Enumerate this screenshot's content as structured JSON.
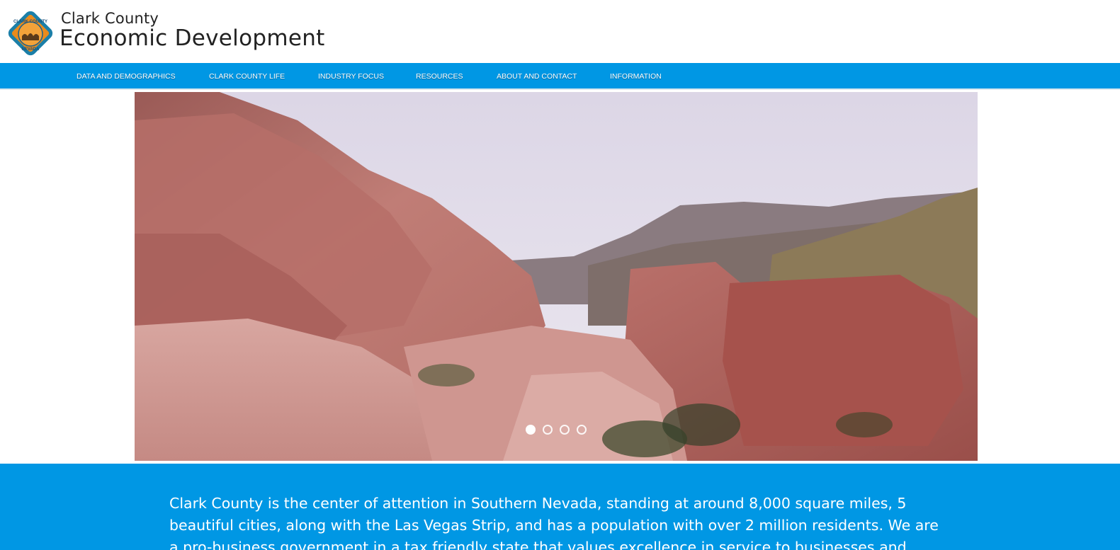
{
  "header": {
    "title_small": "Clark County",
    "title_large": "Economic Development",
    "logo_icon": "clark-county-nevada-seal-icon",
    "logo_text_top": "CLARK COUNTY",
    "logo_text_bottom": "NEVADA"
  },
  "nav": {
    "items": [
      {
        "label": "DATA AND DEMOGRAPHICS"
      },
      {
        "label": "CLARK COUNTY LIFE"
      },
      {
        "label": "INDUSTRY FOCUS"
      },
      {
        "label": "RESOURCES"
      },
      {
        "label": "ABOUT AND CONTACT"
      },
      {
        "label": "INFORMATION"
      }
    ]
  },
  "carousel": {
    "slide_count": 4,
    "active_slide": 1
  },
  "intro": {
    "text": "Clark County is the center of attention in Southern Nevada, standing at around 8,000 square miles, 5 beautiful cities, along with the Las Vegas Strip, and has a population with over 2 million residents. We are a pro-business government in a tax friendly state that values excellence in service to businesses and"
  },
  "colors": {
    "nav_bg": "#0097e4",
    "band_bg": "#0097e4",
    "text_dark": "#222222"
  }
}
